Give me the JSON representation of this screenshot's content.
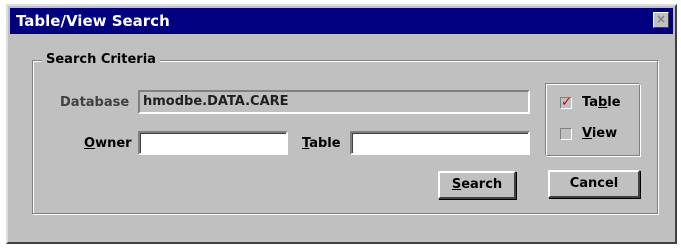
{
  "window": {
    "title": "Table/View  Search",
    "close_glyph": "×"
  },
  "search_criteria": {
    "group_label": "Search Criteria",
    "database_label": "Database",
    "database_value": "hmodbe.DATA.CARE",
    "owner_label_mnemonic": "O",
    "owner_label_rest": "wner",
    "owner_value": "",
    "table_label_mnemonic": "T",
    "table_label_rest": "able",
    "table_value": ""
  },
  "object_type": {
    "table_label_pre": "Ta",
    "table_label_mnemonic": "b",
    "table_label_post": "le",
    "table_checked": true,
    "view_label_mnemonic": "V",
    "view_label_rest": "iew",
    "view_checked": false,
    "check_glyph": "✓"
  },
  "buttons": {
    "search_mnemonic": "S",
    "search_rest": "earch",
    "cancel_label": "Cancel"
  },
  "colors": {
    "titlebar": "#000080",
    "face": "#c0c0c0",
    "check_mark": "#c00000"
  }
}
